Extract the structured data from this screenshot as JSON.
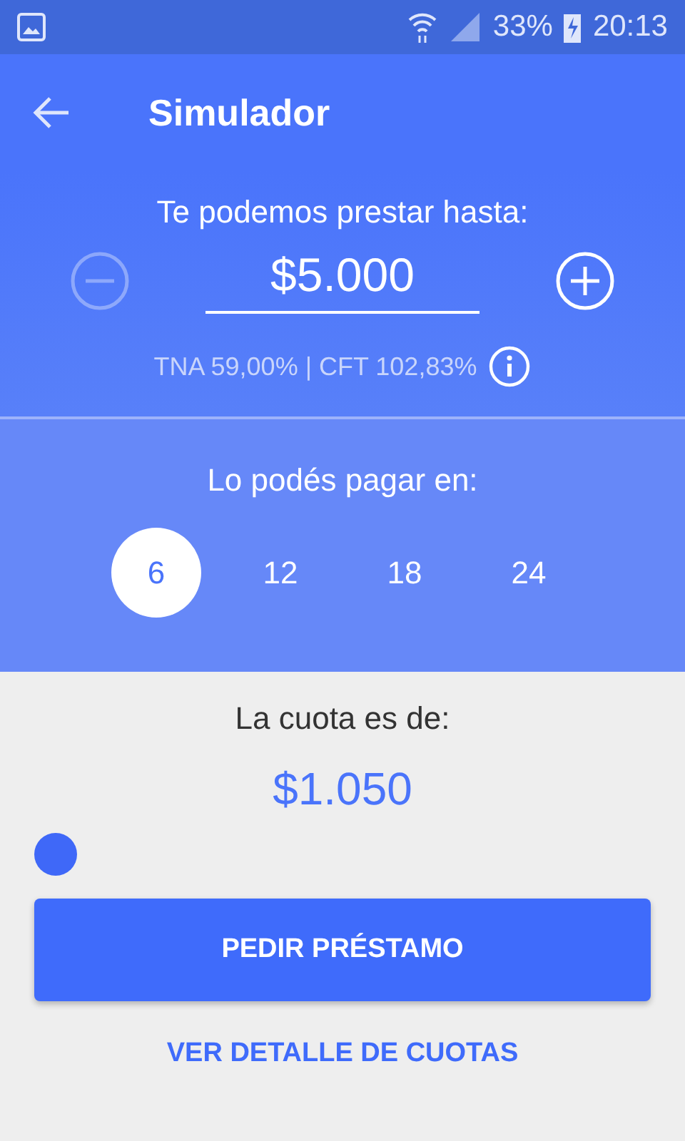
{
  "status_bar": {
    "battery": "33%",
    "time": "20:13"
  },
  "header": {
    "title": "Simulador"
  },
  "amount": {
    "label": "Te podemos prestar hasta:",
    "value": "$5.000",
    "minus_disabled": true,
    "plus_disabled": false,
    "rates": "TNA 59,00% | CFT 102,83%"
  },
  "terms": {
    "label": "Lo podés pagar en:",
    "options": [
      {
        "label": "6",
        "selected": true
      },
      {
        "label": "12",
        "selected": false
      },
      {
        "label": "18",
        "selected": false
      },
      {
        "label": "24",
        "selected": false
      }
    ]
  },
  "installment": {
    "label": "La cuota es de:",
    "value": "$1.050"
  },
  "primary_button": "PEDIR PRÉSTAMO",
  "link": "VER DETALLE DE CUOTAS"
}
